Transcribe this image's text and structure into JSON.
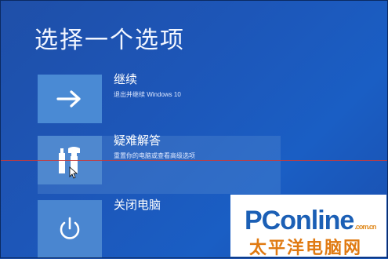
{
  "page": {
    "title": "选择一个选项"
  },
  "options": [
    {
      "label": "继续",
      "description": "退出并继续 Windows 10",
      "icon": "arrow-right-icon"
    },
    {
      "label": "疑难解答",
      "description": "重置你的电脑或查看高级选项",
      "icon": "tools-icon"
    },
    {
      "label": "关闭电脑",
      "description": "",
      "icon": "power-icon"
    }
  ],
  "watermark": {
    "pc": "PC",
    "online": "online",
    "domain": ".com.cn",
    "cn_name": "太平洋电脑网"
  },
  "colors": {
    "background": "#1d56b8",
    "tile": "#4a8ad4",
    "watermark_blue": "#1b5fb5",
    "watermark_orange": "#e07a12"
  }
}
